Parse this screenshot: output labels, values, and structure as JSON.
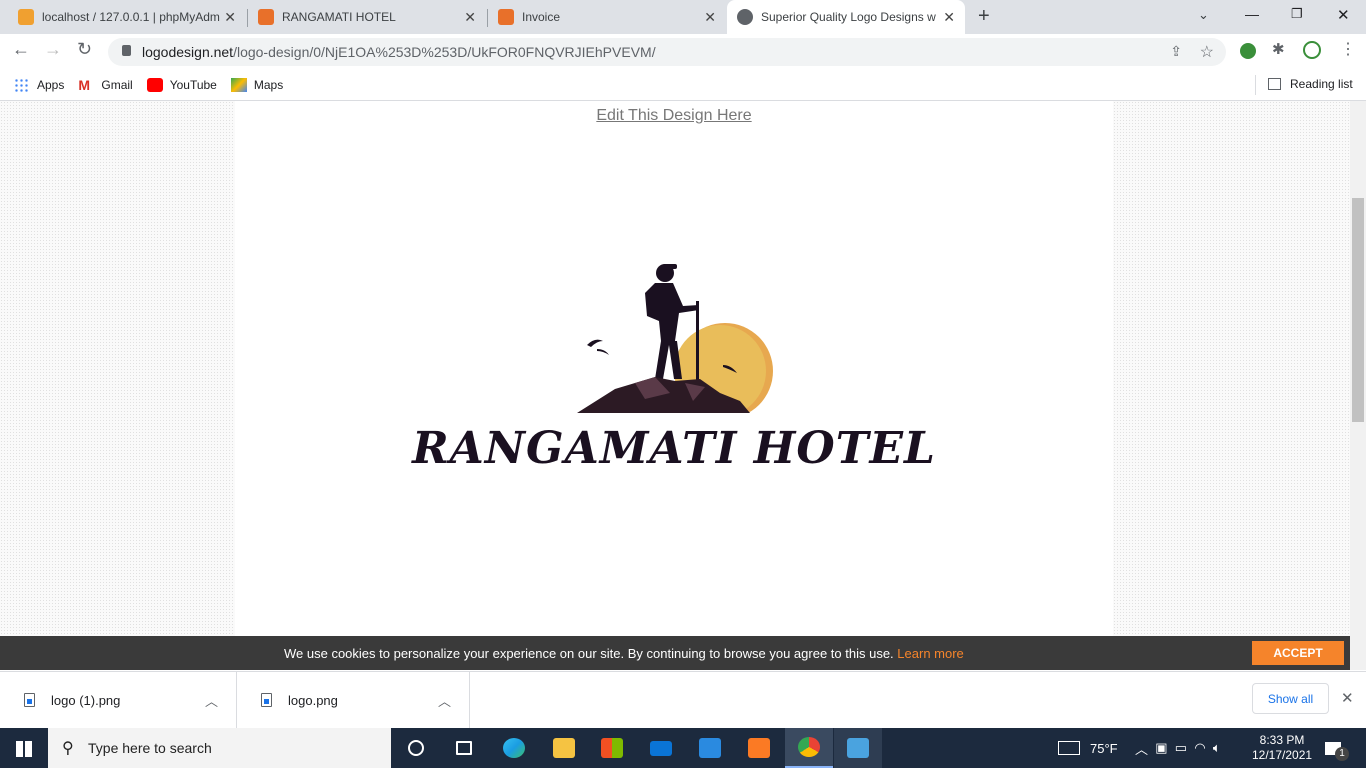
{
  "browser": {
    "tabs": [
      {
        "title": "localhost / 127.0.0.1 | phpMyAdm",
        "icon": "phpmyadmin-icon"
      },
      {
        "title": "RANGAMATI HOTEL",
        "icon": "xampp-icon"
      },
      {
        "title": "Invoice",
        "icon": "xampp-icon"
      },
      {
        "title": "Superior Quality Logo Designs w",
        "icon": "globe-icon",
        "active": true
      }
    ],
    "url_domain": "logodesign.net",
    "url_path": "/logo-design/0/NjE1OA%253D%253D/UkFOR0FNQVRJIEhPVEVM/",
    "bookmarks": [
      "Apps",
      "Gmail",
      "YouTube",
      "Maps"
    ],
    "reading_list": "Reading list"
  },
  "page": {
    "edit_link": "Edit This Design Here",
    "logo_text": "RANGAMATI HOTEL",
    "cookie_text": "We use cookies to personalize your experience on our site. By continuing to browse you agree to this use.",
    "learn_more": "Learn more",
    "accept": "ACCEPT"
  },
  "downloads": {
    "items": [
      "logo (1).png",
      "logo.png"
    ],
    "show_all": "Show all"
  },
  "taskbar": {
    "search_placeholder": "Type here to search",
    "weather": "75°F",
    "time": "8:33 PM",
    "date": "12/17/2021",
    "notifications": "1"
  },
  "colors": {
    "accent": "#f5842b",
    "sun": "#e9bd5a",
    "silhouette": "#1a1020"
  }
}
